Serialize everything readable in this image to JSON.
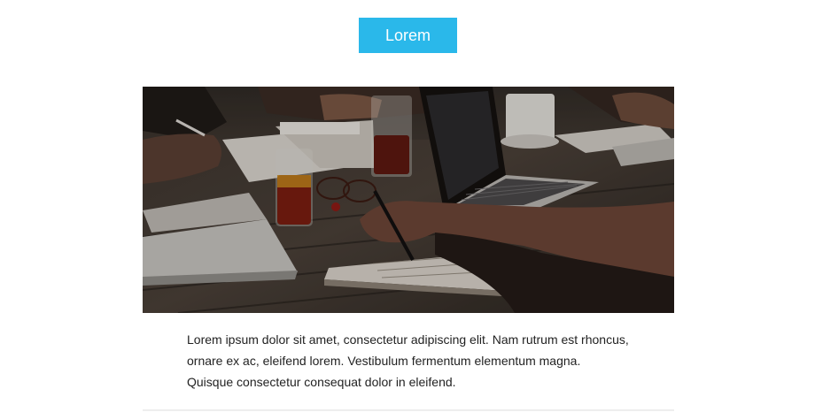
{
  "header": {
    "button_label": "Lorem"
  },
  "hero_image": {
    "description_icon": "meeting-photo"
  },
  "content": {
    "lines": [
      "Lorem ipsum dolor sit amet, consectetur adipiscing elit. Nam rutrum est rhoncus,",
      "ornare ex ac, eleifend lorem. Vestibulum fermentum elementum magna.",
      "Quisque consectetur consequat dolor in eleifend."
    ]
  },
  "colors": {
    "accent": "#2ab8ea",
    "text": "#222222",
    "divider": "#eeeeee"
  }
}
